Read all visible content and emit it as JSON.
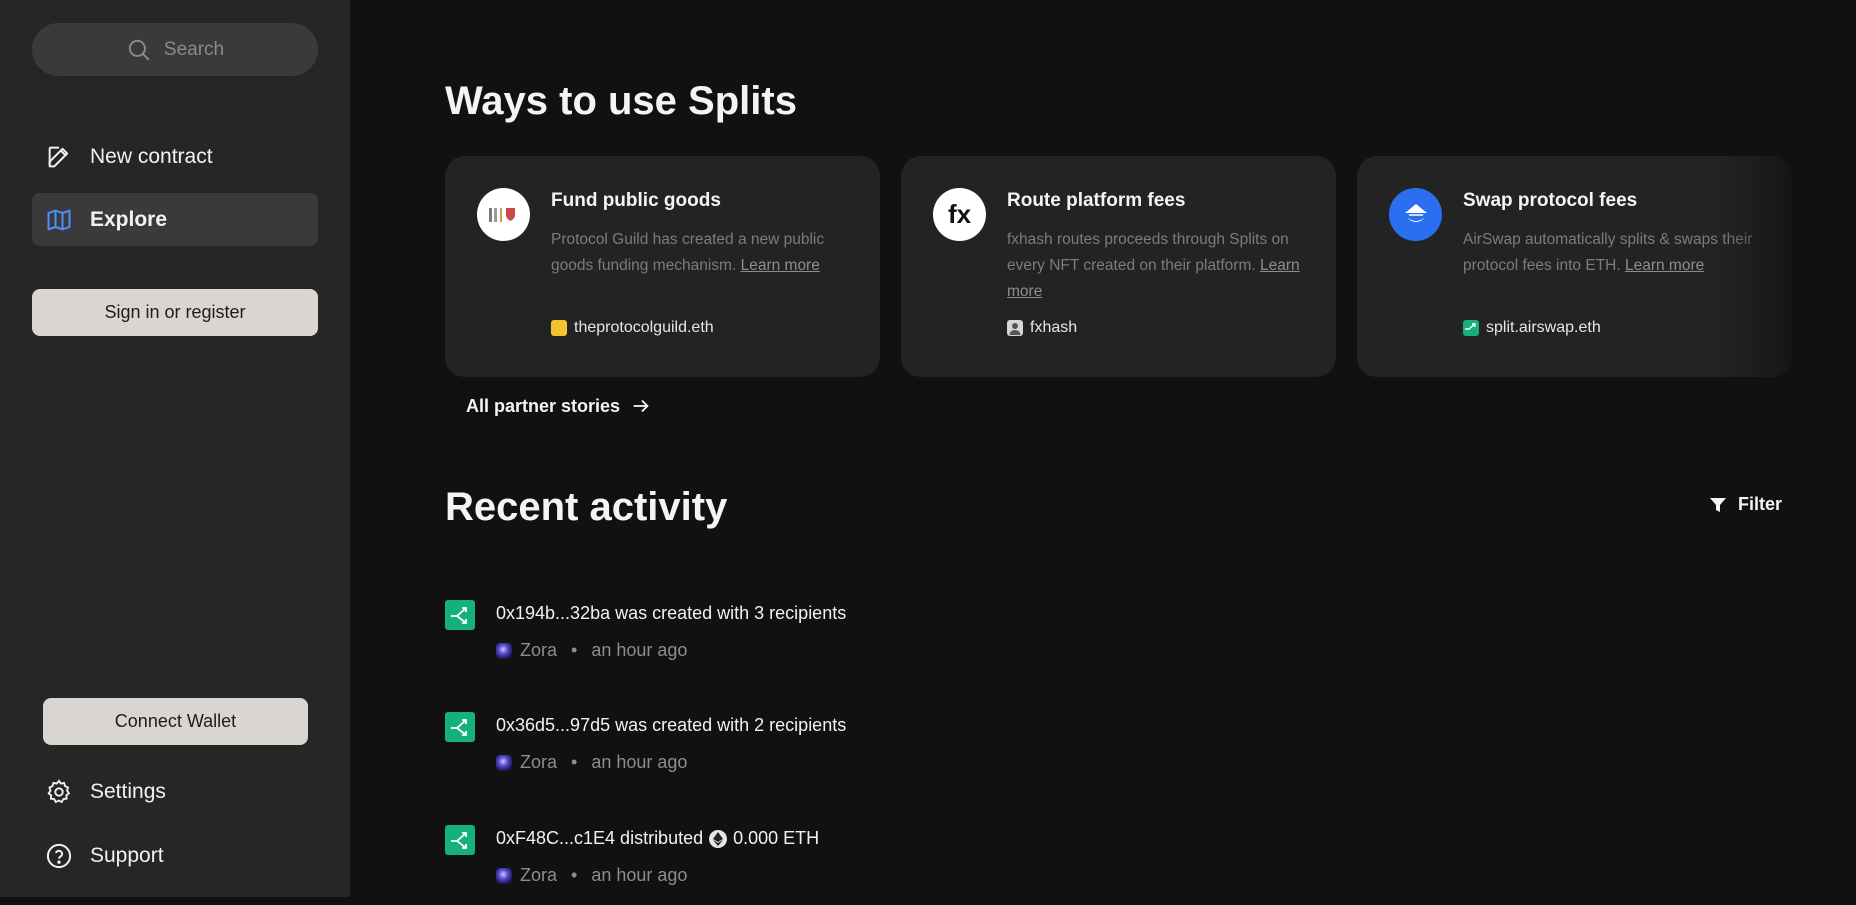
{
  "sidebar": {
    "search_placeholder": "Search",
    "nav": [
      {
        "label": "New contract",
        "icon": "edit-icon"
      },
      {
        "label": "Explore",
        "icon": "map-icon"
      }
    ],
    "sign_in_label": "Sign in or register",
    "connect_wallet_label": "Connect Wallet",
    "bottom_nav": [
      {
        "label": "Settings",
        "icon": "gear-icon"
      },
      {
        "label": "Support",
        "icon": "help-circle-icon"
      }
    ]
  },
  "main": {
    "ways_title": "Ways to use Splits",
    "cards": [
      {
        "title": "Fund public goods",
        "description": "Protocol Guild has created a new public goods funding mechanism.",
        "learn_more": "Learn more",
        "tag": "theprotocolguild.eth",
        "logo": "protocol-guild-logo"
      },
      {
        "title": "Route platform fees",
        "description": "fxhash routes proceeds through Splits on every NFT created on their platform.",
        "learn_more": "Learn more",
        "tag": "fxhash",
        "logo": "fxhash-logo",
        "logo_text": "fx"
      },
      {
        "title": "Swap protocol fees",
        "description": "AirSwap automatically splits & swaps their protocol fees into ETH.",
        "learn_more": "Learn more",
        "tag": "split.airswap.eth",
        "logo": "airswap-logo"
      }
    ],
    "partner_link": "All partner stories",
    "activity_title": "Recent activity",
    "filter_label": "Filter",
    "activity": [
      {
        "text": "0x194b...32ba was created with 3 recipients",
        "network": "Zora",
        "time": "an hour ago",
        "separator": "•"
      },
      {
        "text": "0x36d5...97d5 was created with 2 recipients",
        "network": "Zora",
        "time": "an hour ago",
        "separator": "•"
      },
      {
        "text_prefix": "0xF48C...c1E4 distributed",
        "amount": "0.000 ETH",
        "network": "Zora",
        "time": "an hour ago",
        "separator": "•"
      }
    ]
  },
  "colors": {
    "background": "#111111",
    "sidebar": "#262626",
    "card": "#232323",
    "split_green": "#16b07c",
    "button_light": "#d9d6d2",
    "accent_blue": "#4f8ef7"
  }
}
